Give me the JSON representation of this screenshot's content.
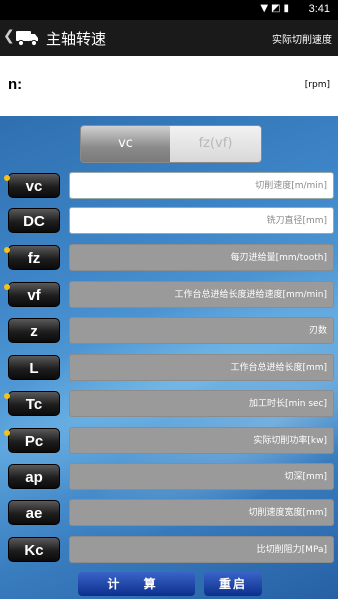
{
  "status": {
    "time": "3:41",
    "icons": [
      "wifi-icon",
      "no-sim-icon",
      "battery-icon"
    ]
  },
  "header": {
    "title": "主轴转速",
    "action": "实际切削速度"
  },
  "result": {
    "label": "n:",
    "unit": "[rpm]"
  },
  "mode_toggle": {
    "selected": "vc",
    "other": "fz(vf)"
  },
  "rows": [
    {
      "var": "vc",
      "placeholder": "切削速度[m/min]",
      "dot": true,
      "enabled": true
    },
    {
      "var": "DC",
      "placeholder": "铣刀直径[mm]",
      "dot": false,
      "enabled": true
    },
    {
      "var": "fz",
      "placeholder": "每刃进给量[mm/tooth]",
      "dot": true,
      "enabled": false
    },
    {
      "var": "vf",
      "placeholder": "工作台总进给长度进给速度[mm/min]",
      "dot": true,
      "enabled": false
    },
    {
      "var": "z",
      "placeholder": "刃数",
      "dot": false,
      "enabled": false
    },
    {
      "var": "L",
      "placeholder": "工作台总进给长度[mm]",
      "dot": false,
      "enabled": false
    },
    {
      "var": "Tc",
      "placeholder": "加工时长[min sec]",
      "dot": true,
      "enabled": false
    },
    {
      "var": "Pc",
      "placeholder": "实际切削功率[kw]",
      "dot": true,
      "enabled": false
    },
    {
      "var": "ap",
      "placeholder": "切深[mm]",
      "dot": false,
      "enabled": false
    },
    {
      "var": "ae",
      "placeholder": "切削速度宽度[mm]",
      "dot": false,
      "enabled": false
    },
    {
      "var": "Kc",
      "placeholder": "比切削阻力[MPa]",
      "dot": false,
      "enabled": false
    }
  ],
  "buttons": {
    "calculate": "计 算",
    "reset": "重启"
  }
}
